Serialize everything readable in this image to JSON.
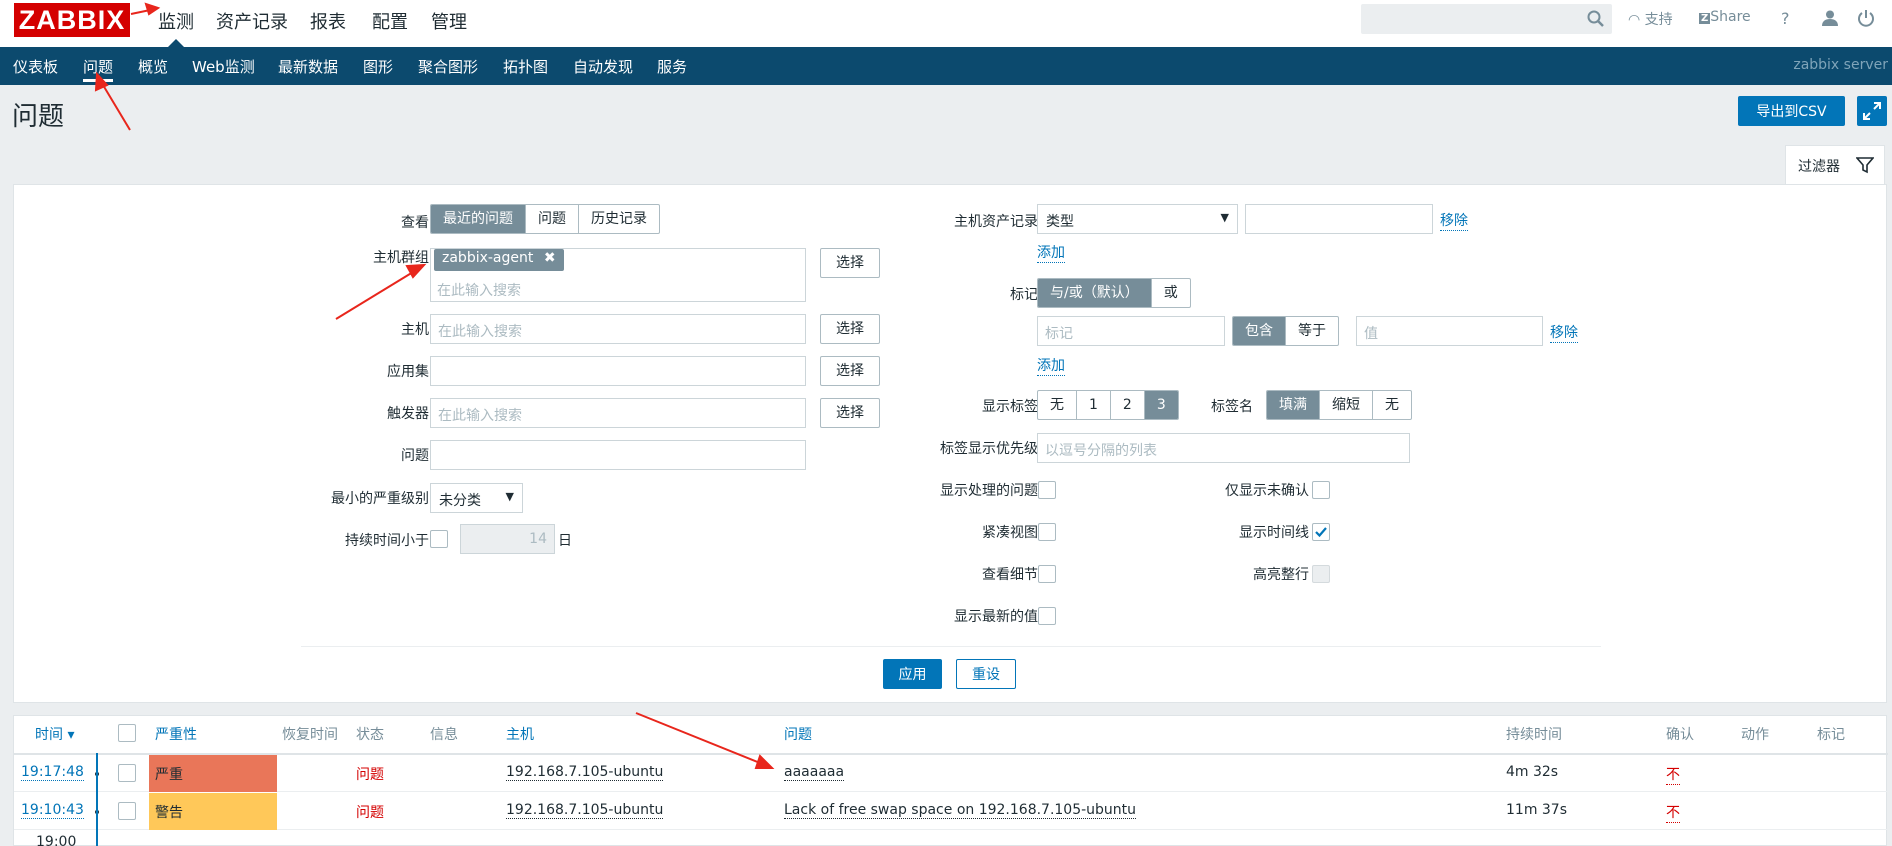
{
  "logo": "ZABBIX",
  "main_nav": [
    "监测",
    "资产记录",
    "报表",
    "配置",
    "管理"
  ],
  "top_icons": {
    "support": "支持",
    "share": "Share",
    "help": "?"
  },
  "sub_nav": [
    "仪表板",
    "问题",
    "概览",
    "Web监测",
    "最新数据",
    "图形",
    "聚合图形",
    "拓扑图",
    "自动发现",
    "服务"
  ],
  "server_name": "zabbix server",
  "page_title": "问题",
  "export_label": "导出到CSV",
  "filter_label": "过滤器",
  "filter": {
    "view_label": "查看",
    "view_options": [
      "最近的问题",
      "问题",
      "历史记录"
    ],
    "hostgroup_label": "主机群组",
    "hostgroup_tag": "zabbix-agent",
    "search_placeholder": "在此输入搜索",
    "select_label": "选择",
    "host_label": "主机",
    "app_label": "应用集",
    "trigger_label": "触发器",
    "problem_label": "问题",
    "severity_label": "最小的严重级别",
    "severity_value": "未分类",
    "duration_label": "持续时间小于",
    "duration_value": "14",
    "duration_unit": "日",
    "inventory_label": "主机资产记录",
    "inventory_type": "类型",
    "remove_label": "移除",
    "add_label": "添加",
    "tags_label": "标记",
    "tags_mode": [
      "与/或（默认）",
      "或"
    ],
    "tag_placeholder": "标记",
    "tag_ops": [
      "包含",
      "等于"
    ],
    "value_placeholder": "值",
    "show_tags_label": "显示标签",
    "show_tags_options": [
      "无",
      "1",
      "2",
      "3"
    ],
    "tag_name_label": "标签名",
    "tag_name_options": [
      "填满",
      "缩短",
      "无"
    ],
    "tag_priority_label": "标签显示优先级",
    "tag_priority_placeholder": "以逗号分隔的列表",
    "show_suppressed_label": "显示处理的问题",
    "unack_only_label": "仅显示未确认",
    "compact_label": "紧凑视图",
    "timeline_label": "显示时间线",
    "details_label": "查看细节",
    "highlight_label": "高亮整行",
    "latest_values_label": "显示最新的值",
    "apply_label": "应用",
    "reset_label": "重设"
  },
  "table": {
    "headers": {
      "time": "时间 ▾",
      "severity": "严重性",
      "recovery": "恢复时间",
      "status": "状态",
      "info": "信息",
      "host": "主机",
      "problem": "问题",
      "duration": "持续时间",
      "ack": "确认",
      "actions": "动作",
      "tags": "标记"
    },
    "rows": [
      {
        "time": "19:17:48",
        "severity": "严重",
        "status": "问题",
        "host": "192.168.7.105-ubuntu",
        "problem": "aaaaaaa",
        "duration": "4m 32s",
        "ack": "不"
      },
      {
        "time": "19:10:43",
        "severity": "警告",
        "status": "问题",
        "host": "192.168.7.105-ubuntu",
        "problem": "Lack of free swap space on 192.168.7.105-ubuntu",
        "duration": "11m 37s",
        "ack": "不"
      }
    ],
    "timeline_hour": "19:00"
  },
  "colors": {
    "nav_bg": "#0c4a6e",
    "accent": "#0275b8",
    "severity_high": "#e97659",
    "severity_warning": "#ffc859",
    "problem_red": "#d40000"
  }
}
